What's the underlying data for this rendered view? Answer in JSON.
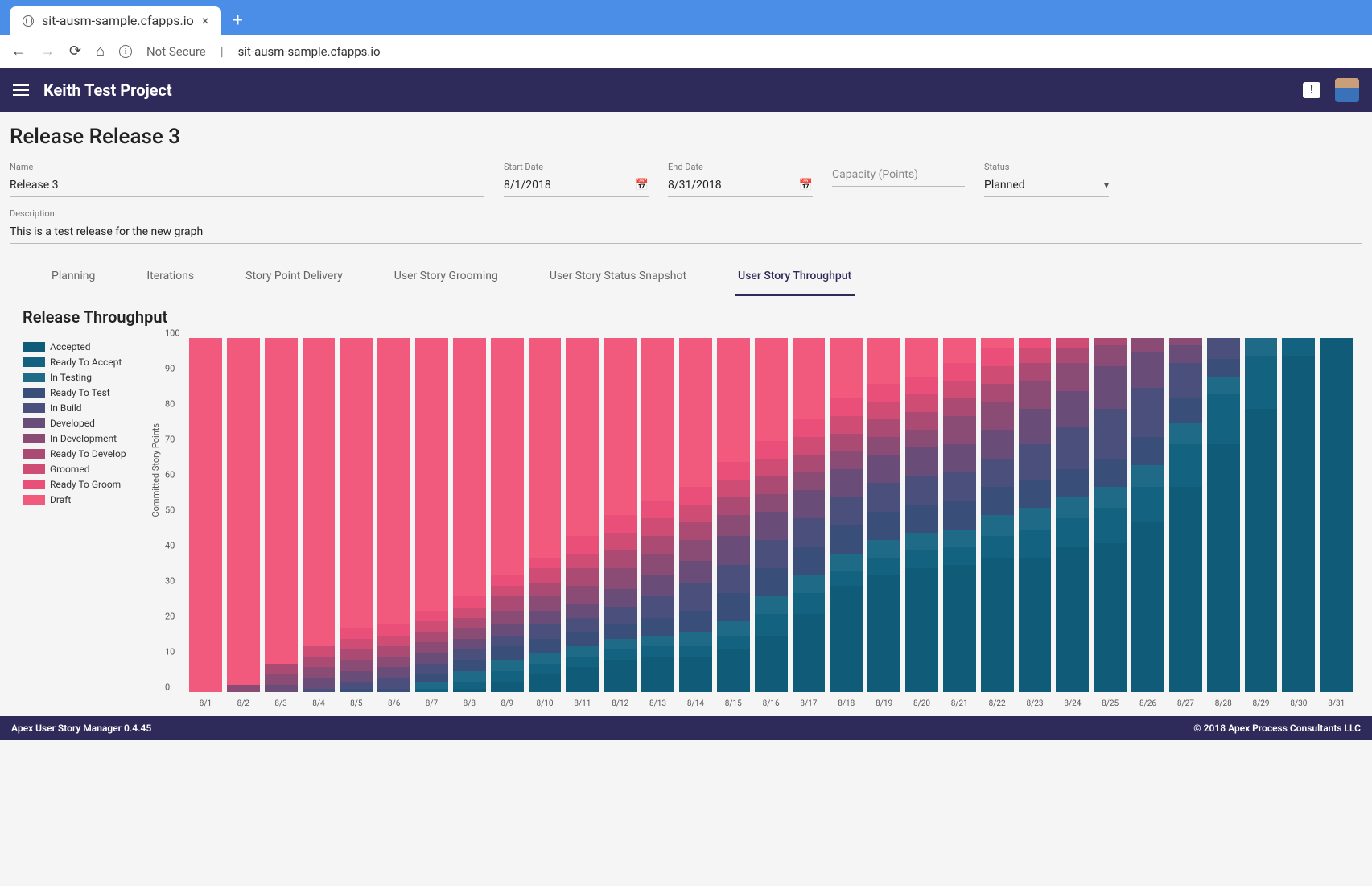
{
  "browser": {
    "tab_title": "sit-ausm-sample.cfapps.io",
    "not_secure": "Not Secure",
    "url": "sit-ausm-sample.cfapps.io"
  },
  "header": {
    "project_title": "Keith Test Project"
  },
  "page": {
    "title": "Release Release 3",
    "fields": {
      "name_label": "Name",
      "name_value": "Release 3",
      "start_label": "Start Date",
      "start_value": "8/1/2018",
      "end_label": "End Date",
      "end_value": "8/31/2018",
      "capacity_label": "",
      "capacity_placeholder": "Capacity (Points)",
      "status_label": "Status",
      "status_value": "Planned",
      "desc_label": "Description",
      "desc_value": "This is a test release for the new graph"
    },
    "tabs": [
      "Planning",
      "Iterations",
      "Story Point Delivery",
      "User Story Grooming",
      "User Story Status Snapshot",
      "User Story Throughput"
    ],
    "active_tab_index": 5
  },
  "chart_data": {
    "type": "bar",
    "title": "Release Throughput",
    "ylabel": "Committed Story Points",
    "ylim": [
      0,
      100
    ],
    "yticks": [
      0,
      10,
      20,
      30,
      40,
      50,
      60,
      70,
      80,
      90,
      100
    ],
    "categories": [
      "8/1",
      "8/2",
      "8/3",
      "8/4",
      "8/5",
      "8/6",
      "8/7",
      "8/8",
      "8/9",
      "8/10",
      "8/11",
      "8/12",
      "8/13",
      "8/14",
      "8/15",
      "8/16",
      "8/17",
      "8/18",
      "8/19",
      "8/20",
      "8/21",
      "8/22",
      "8/23",
      "8/24",
      "8/25",
      "8/26",
      "8/27",
      "8/28",
      "8/29",
      "8/30",
      "8/31"
    ],
    "series": [
      {
        "name": "Accepted",
        "color": "#0f5b78",
        "values": [
          0,
          0,
          0,
          0,
          0,
          0,
          0,
          1,
          3,
          5,
          7,
          9,
          10,
          10,
          12,
          16,
          22,
          30,
          33,
          35,
          36,
          38,
          38,
          41,
          42,
          48,
          58,
          70,
          80,
          95,
          100
        ]
      },
      {
        "name": "Ready To Accept",
        "color": "#13627f",
        "values": [
          0,
          0,
          0,
          0,
          0,
          0,
          1,
          2,
          3,
          3,
          3,
          3,
          3,
          3,
          4,
          6,
          6,
          4,
          5,
          5,
          5,
          6,
          8,
          8,
          10,
          10,
          12,
          14,
          15,
          5,
          0
        ]
      },
      {
        "name": "In Testing",
        "color": "#1e6a87",
        "values": [
          0,
          0,
          0,
          0,
          0,
          0,
          2,
          3,
          3,
          3,
          3,
          3,
          3,
          4,
          4,
          5,
          5,
          5,
          5,
          5,
          5,
          6,
          6,
          6,
          6,
          6,
          6,
          5,
          5,
          0,
          0
        ]
      },
      {
        "name": "Ready To Test",
        "color": "#3a4e7a",
        "values": [
          0,
          0,
          0,
          0,
          1,
          1,
          2,
          3,
          4,
          4,
          4,
          4,
          5,
          6,
          8,
          8,
          8,
          8,
          8,
          8,
          8,
          8,
          8,
          8,
          8,
          8,
          7,
          5,
          0,
          0,
          0
        ]
      },
      {
        "name": "In Build",
        "color": "#4a4f7c",
        "values": [
          0,
          0,
          0,
          1,
          2,
          3,
          3,
          3,
          3,
          4,
          4,
          5,
          6,
          8,
          8,
          8,
          8,
          8,
          8,
          8,
          8,
          8,
          10,
          12,
          14,
          14,
          10,
          6,
          0,
          0,
          0
        ]
      },
      {
        "name": "Developed",
        "color": "#6a4c78",
        "values": [
          0,
          0,
          2,
          3,
          3,
          3,
          3,
          3,
          3,
          4,
          4,
          5,
          6,
          6,
          8,
          8,
          8,
          8,
          8,
          8,
          8,
          8,
          10,
          10,
          12,
          10,
          5,
          0,
          0,
          0,
          0
        ]
      },
      {
        "name": "In Development",
        "color": "#8a4c75",
        "values": [
          0,
          2,
          3,
          3,
          3,
          3,
          3,
          3,
          4,
          4,
          5,
          6,
          6,
          6,
          6,
          5,
          5,
          5,
          5,
          5,
          8,
          8,
          8,
          8,
          6,
          4,
          2,
          0,
          0,
          0,
          0
        ]
      },
      {
        "name": "Ready To Develop",
        "color": "#ab4b73",
        "values": [
          0,
          0,
          3,
          3,
          3,
          3,
          3,
          3,
          4,
          4,
          5,
          5,
          5,
          5,
          5,
          5,
          5,
          5,
          5,
          5,
          5,
          5,
          5,
          4,
          2,
          0,
          0,
          0,
          0,
          0,
          0
        ]
      },
      {
        "name": "Groomed",
        "color": "#cf4d74",
        "values": [
          0,
          0,
          0,
          3,
          3,
          3,
          3,
          3,
          3,
          4,
          4,
          5,
          5,
          5,
          5,
          5,
          5,
          5,
          5,
          5,
          5,
          5,
          4,
          3,
          0,
          0,
          0,
          0,
          0,
          0,
          0
        ]
      },
      {
        "name": "Ready To Groom",
        "color": "#e94f78",
        "values": [
          0,
          0,
          0,
          0,
          3,
          3,
          3,
          3,
          3,
          3,
          5,
          5,
          5,
          5,
          5,
          5,
          5,
          5,
          5,
          5,
          5,
          5,
          3,
          0,
          0,
          0,
          0,
          0,
          0,
          0,
          0
        ]
      },
      {
        "name": "Draft",
        "color": "#f15a7d",
        "values": [
          100,
          98,
          92,
          87,
          82,
          81,
          77,
          73,
          67,
          62,
          56,
          50,
          46,
          42,
          35,
          29,
          23,
          17,
          13,
          11,
          7,
          3,
          0,
          0,
          0,
          0,
          0,
          0,
          0,
          0,
          0
        ]
      }
    ]
  },
  "footer": {
    "left": "Apex User Story Manager 0.4.45",
    "right": "© 2018 Apex Process Consultants LLC"
  }
}
